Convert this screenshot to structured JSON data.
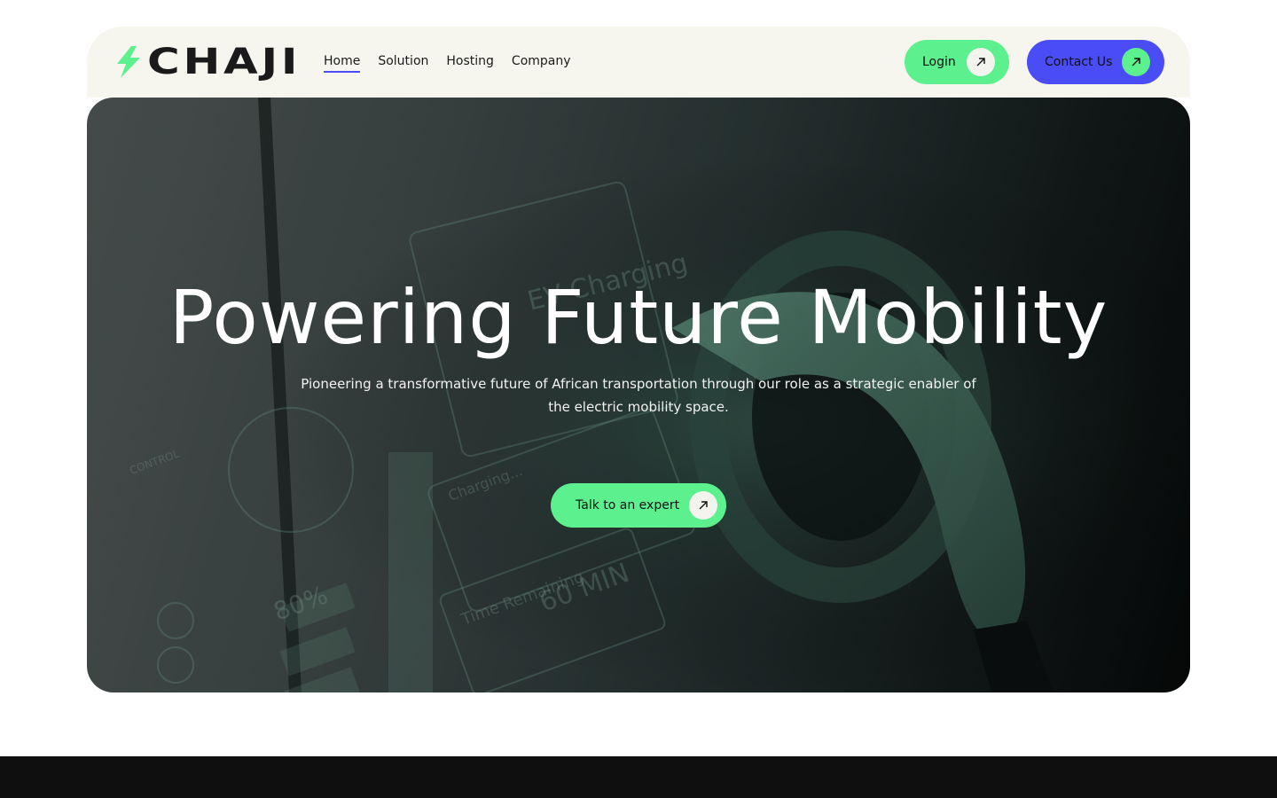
{
  "brand": {
    "name": "CHAJI",
    "accent_green": "#5cf08f",
    "accent_blue": "#4a4cf6",
    "logo_icon": "lightning-bolt-icon"
  },
  "nav": {
    "links": [
      {
        "label": "Home",
        "active": true
      },
      {
        "label": "Solution",
        "active": false
      },
      {
        "label": "Hosting",
        "active": false
      },
      {
        "label": "Company",
        "active": false
      }
    ],
    "login_label": "Login",
    "contact_label": "Contact Us",
    "arrow_icon": "arrow-up-right-icon"
  },
  "hero": {
    "title": "Powering Future Mobility",
    "subtitle": "Pioneering a transformative future of African transportation through our role as a strategic enabler of the electric mobility space.",
    "cta_label": "Talk to an expert",
    "background": {
      "overlay_texts": [
        "EV Charging",
        "Charging...",
        "Time Remaining",
        "60 MIN",
        "80%",
        "CONTROL"
      ]
    }
  }
}
